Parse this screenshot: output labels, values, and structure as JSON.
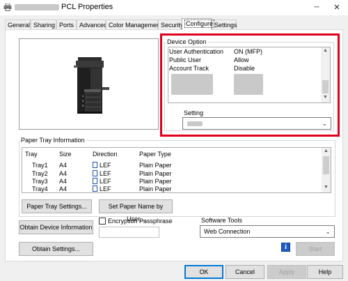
{
  "window": {
    "title": "PCL Properties",
    "controls": {
      "minimize": "─",
      "close": "✕"
    }
  },
  "tabs": [
    {
      "label": "General"
    },
    {
      "label": "Sharing"
    },
    {
      "label": "Ports"
    },
    {
      "label": "Advanced"
    },
    {
      "label": "Color Management"
    },
    {
      "label": "Security"
    },
    {
      "label": "Configure"
    },
    {
      "label": "Settings"
    }
  ],
  "device_option": {
    "legend": "Device Option",
    "rows": [
      {
        "name": "User Authentication",
        "value": "ON (MFP)"
      },
      {
        "name": "Public User",
        "value": "Allow"
      },
      {
        "name": "Account Track",
        "value": "Disable"
      }
    ],
    "setting_label": "Setting"
  },
  "paper_tray": {
    "legend": "Paper Tray Information",
    "columns": [
      "Tray",
      "Size",
      "Direction",
      "Paper Type"
    ],
    "rows": [
      {
        "tray": "Tray1",
        "size": "A4",
        "direction": "LEF",
        "type": "Plain Paper"
      },
      {
        "tray": "Tray2",
        "size": "A4",
        "direction": "LEF",
        "type": "Plain Paper"
      },
      {
        "tray": "Tray3",
        "size": "A4",
        "direction": "LEF",
        "type": "Plain Paper"
      },
      {
        "tray": "Tray4",
        "size": "A4",
        "direction": "LEF",
        "type": "Plain Paper"
      }
    ],
    "paper_tray_settings": "Paper Tray Settings...",
    "set_paper_name": "Set Paper Name by User..."
  },
  "obtain_device_info": "Obtain Device Information",
  "obtain_settings": "Obtain Settings...",
  "encryption": {
    "label": "Encryption Passphrase",
    "checked": false,
    "value": ""
  },
  "software_tools": {
    "label": "Software Tools",
    "selected": "Web Connection",
    "info_icon": "i",
    "start": "Start"
  },
  "footer": {
    "ok": "OK",
    "cancel": "Cancel",
    "apply": "Apply",
    "help": "Help"
  },
  "colors": {
    "highlight": "#e0001b",
    "accent": "#0078d7"
  }
}
